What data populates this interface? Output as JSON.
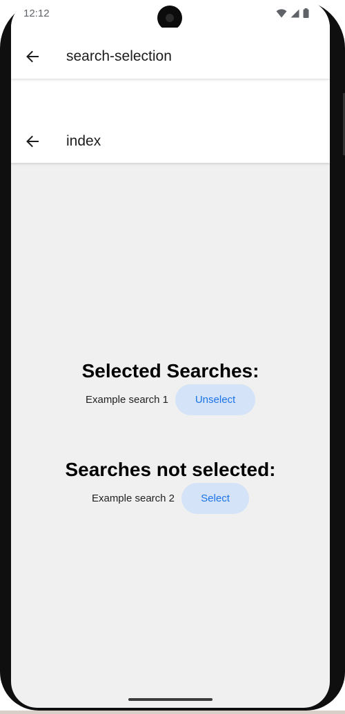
{
  "status_bar": {
    "time": "12:12",
    "icons": [
      "wifi-icon",
      "cell-signal-icon",
      "battery-icon"
    ]
  },
  "appbars": [
    {
      "title": "search-selection",
      "back_icon": "arrow-back-icon"
    },
    {
      "title": "index",
      "back_icon": "arrow-back-icon"
    }
  ],
  "selected": {
    "heading": "Selected Searches:",
    "items": [
      {
        "label": "Example search 1",
        "button": "Unselect"
      }
    ]
  },
  "not_selected": {
    "heading": "Searches not selected:",
    "items": [
      {
        "label": "Example search 2",
        "button": "Select"
      }
    ]
  },
  "colors": {
    "background": "#f0f0f0",
    "appbar": "#ffffff",
    "button_bg": "#d4e3f7",
    "button_text": "#1a73e8"
  }
}
